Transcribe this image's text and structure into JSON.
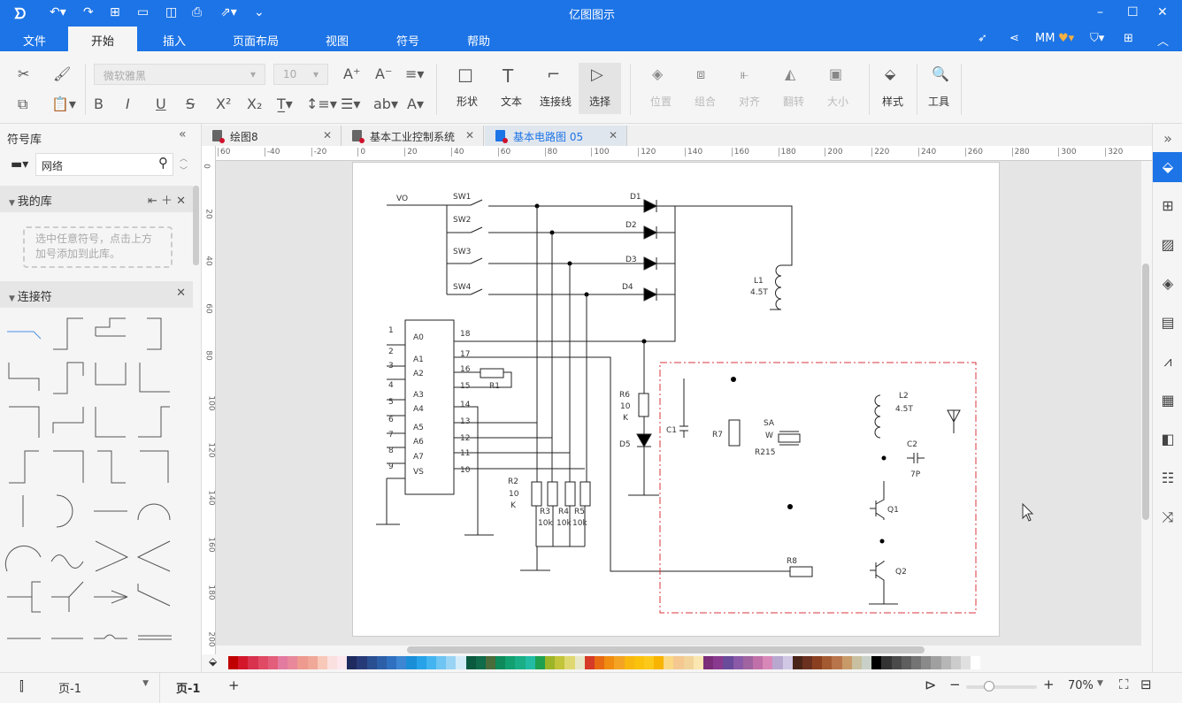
{
  "app": {
    "title": "亿图图示"
  },
  "user": {
    "name": "MM"
  },
  "menu": [
    "文件",
    "开始",
    "插入",
    "页面布局",
    "视图",
    "符号",
    "帮助"
  ],
  "ribbon": {
    "font": "微软雅黑",
    "font_size": "10",
    "shape": "形状",
    "text": "文本",
    "connector": "连接线",
    "select": "选择",
    "position": "位置",
    "group": "组合",
    "align": "对齐",
    "flip": "翻转",
    "size": "大小",
    "style": "样式",
    "tools": "工具"
  },
  "library": {
    "title": "符号库",
    "search_value": "网络",
    "my_library": "我的库",
    "my_library_hint": "选中任意符号，点击上方加号添加到此库。",
    "connectors": "连接符"
  },
  "tabs": [
    {
      "label": "绘图8"
    },
    {
      "label": "基本工业控制系统"
    },
    {
      "label": "基本电路图 05",
      "active": true
    }
  ],
  "ruler": {
    "h": [
      "60",
      "-40",
      "-20",
      "0",
      "20",
      "40",
      "60",
      "80",
      "100",
      "120",
      "140",
      "160",
      "180",
      "200",
      "220",
      "240",
      "260",
      "280",
      "300",
      "320"
    ],
    "v": [
      "0",
      "20",
      "40",
      "60",
      "80",
      "100",
      "120",
      "140",
      "160",
      "180",
      "200"
    ]
  },
  "circuit": {
    "VO": "VO",
    "SW1": "SW1",
    "SW2": "SW2",
    "SW3": "SW3",
    "SW4": "SW4",
    "D1": "D1",
    "D2": "D2",
    "D3": "D3",
    "D4": "D4",
    "D5": "D5",
    "L1": "L1",
    "L1v": "4.5T",
    "L2": "L2",
    "L2v": "4.5T",
    "pins_left": [
      "1",
      "2",
      "3",
      "4",
      "5",
      "6",
      "7",
      "8",
      "9"
    ],
    "pins_names": [
      "A0",
      "A1",
      "A2",
      "A3",
      "A4",
      "A5",
      "A6",
      "A7",
      "VS"
    ],
    "pins_right": [
      "18",
      "17",
      "16",
      "15",
      "14",
      "13",
      "12",
      "11",
      "10"
    ],
    "R1": "R1",
    "R2": "R2",
    "R2v1": "10",
    "R2v2": "K",
    "R3": "R3",
    "R4": "R4",
    "R5": "R5",
    "R345v": "10k",
    "R6": "R6",
    "R6v1": "10",
    "R6v2": "K",
    "R7": "R7",
    "R8": "R8",
    "C1": "C1",
    "C2": "C2",
    "C2v": "7P",
    "SA1": "SA",
    "SA2": "W",
    "SA3": "R215",
    "Q1": "Q1",
    "Q2": "Q2"
  },
  "palette": [
    "#c00000",
    "#d3162a",
    "#d8324f",
    "#e04a64",
    "#e35e7a",
    "#e37aa0",
    "#e8889a",
    "#ee9a8e",
    "#f0a898",
    "#f8c8b8",
    "#fbe0e0",
    "#fde8ee",
    "#1f2a5e",
    "#273a78",
    "#2a4f91",
    "#2c5fa8",
    "#3070c0",
    "#3d86d3",
    "#1a8fd8",
    "#27a2e8",
    "#43b4f0",
    "#6ec4f2",
    "#9ad4f5",
    "#d4ecf8",
    "#0b5a3f",
    "#0f6b4a",
    "#4a6b3a",
    "#0e8a5a",
    "#12a070",
    "#1aae86",
    "#22bca4",
    "#1ea050",
    "#9cb428",
    "#c2c43a",
    "#dfd870",
    "#e8e8c8",
    "#d53b26",
    "#e76a12",
    "#f08c10",
    "#f4a422",
    "#f8b810",
    "#fac20c",
    "#fcc81a",
    "#f8b400",
    "#fad884",
    "#f4c890",
    "#f2d49a",
    "#fae6b0",
    "#7b2d7a",
    "#8a3a8e",
    "#6a4a9a",
    "#8a5aa8",
    "#a064a0",
    "#c070a8",
    "#d888b8",
    "#b8a8d0",
    "#d0c8e4",
    "#4a2418",
    "#6a3020",
    "#8a4020",
    "#a45a30",
    "#b8744a",
    "#c89a6a",
    "#c8c0a0",
    "#c8d0c8",
    "#000000",
    "#333333",
    "#4a4a4a",
    "#5e5e5e",
    "#747474",
    "#8a8a8a",
    "#a0a0a0",
    "#b6b6b6",
    "#cccccc",
    "#e0e0e0",
    "#ffffff"
  ],
  "status": {
    "page_select": "页-1",
    "page_tab": "页-1",
    "zoom": "70%",
    "zoom_level": 0.3
  }
}
